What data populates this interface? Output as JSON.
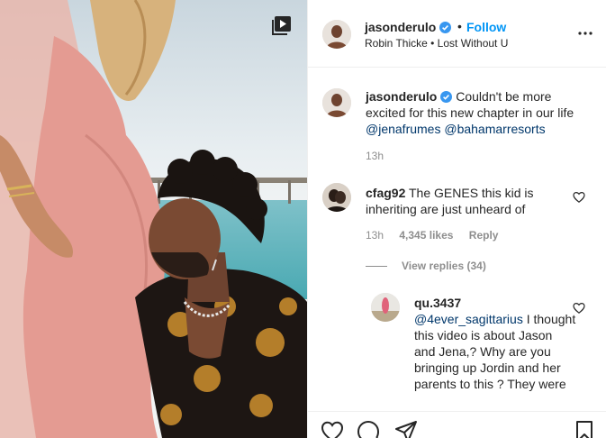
{
  "post": {
    "author": "jasonderulo",
    "follow_label": "Follow",
    "dot": "•",
    "audio": "Robin Thicke • Lost Without U"
  },
  "caption": {
    "author": "jasonderulo",
    "text_before": "Couldn't be more excited for this new chapter in our life",
    "mentions": [
      "@jenafrumes",
      "@bahamarresorts"
    ],
    "time": "13h"
  },
  "comments": [
    {
      "author": "cfag92",
      "text": "The GENES this kid is inheriting are just unheard of",
      "time": "13h",
      "likes": "4,345 likes",
      "reply_label": "Reply",
      "view_replies": "View replies (34)"
    }
  ],
  "reply": {
    "author": "qu.3437",
    "mention": "@4ever_sagittarius",
    "text": "I thought this video is about Jason and Jena,? Why are you bringing up Jordin and her parents to this ? They were"
  },
  "icons": {
    "video": "video-icon",
    "verified": "verified-badge-icon",
    "more": "more-options-icon",
    "heart": "heart-icon",
    "comment": "comment-icon",
    "share": "share-icon",
    "save": "bookmark-icon"
  },
  "colors": {
    "follow_blue": "#0095f6",
    "mention_blue": "#00376b",
    "muted": "#8e8e8e",
    "verified_blue": "#3897f0"
  }
}
